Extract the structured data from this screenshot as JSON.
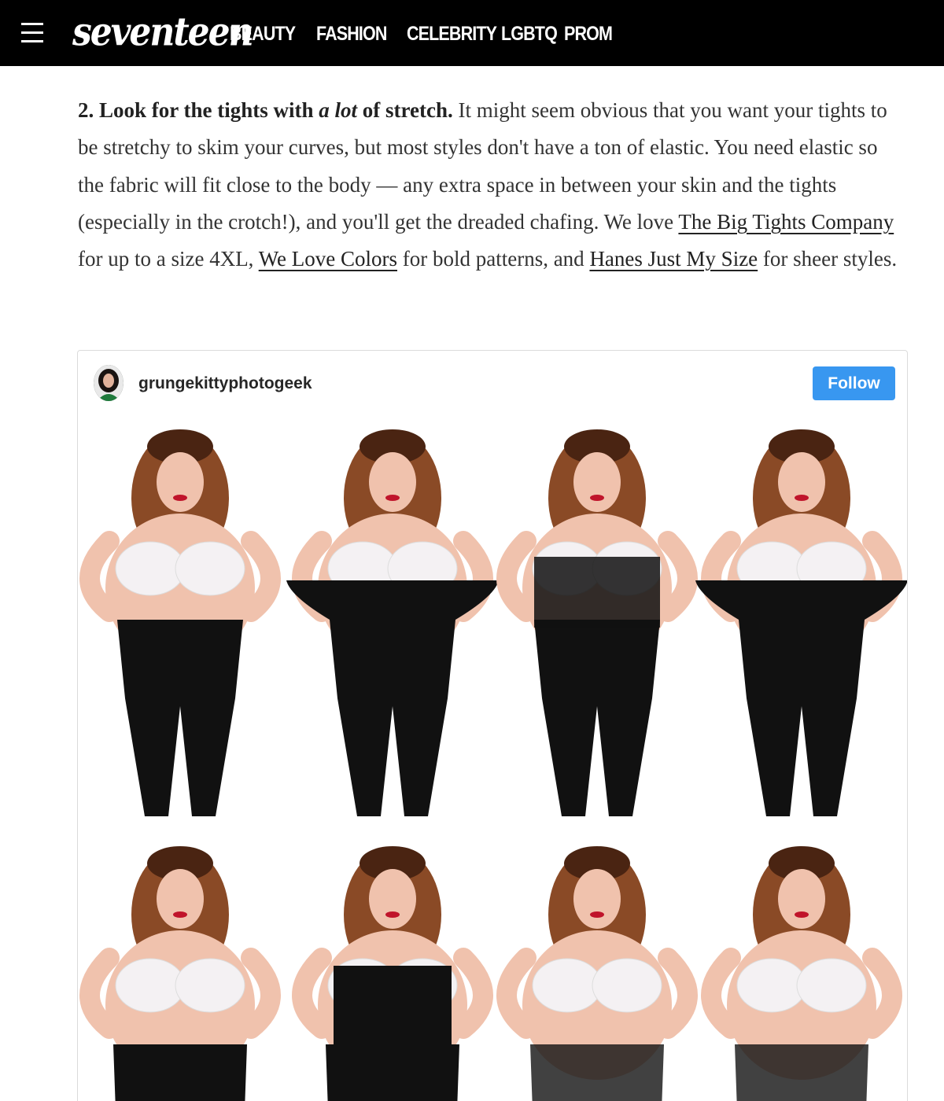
{
  "site": {
    "logo": "seventeen",
    "nav": [
      "BEAUTY",
      "FASHION",
      "CELEBRITY",
      "LGBTQ",
      "PROM"
    ]
  },
  "article": {
    "lead_prefix": "2. Look for the tights with ",
    "lead_emph": "a lot",
    "lead_suffix": " of stretch.",
    "text_1": " It might seem obvious that you want your tights to be stretchy to skim your curves, but most styles don't have a ton of elastic. You need elastic so the fabric will fit close to the body — any extra space in between your skin and the tights (especially in the crotch!), and you'll get the dreaded chafing. We love ",
    "link_1": "The Big Tights Company",
    "text_2": " for up to a size 4XL, ",
    "link_2": "We Love Colors",
    "text_3": " for bold patterns, and ",
    "link_3": "Hanes Just My Size",
    "text_4": " for sheer styles."
  },
  "embed": {
    "username": "grungekittyphotogeek",
    "follow_label": "Follow",
    "follow_color": "#3897f0",
    "photo_panels": 8
  }
}
